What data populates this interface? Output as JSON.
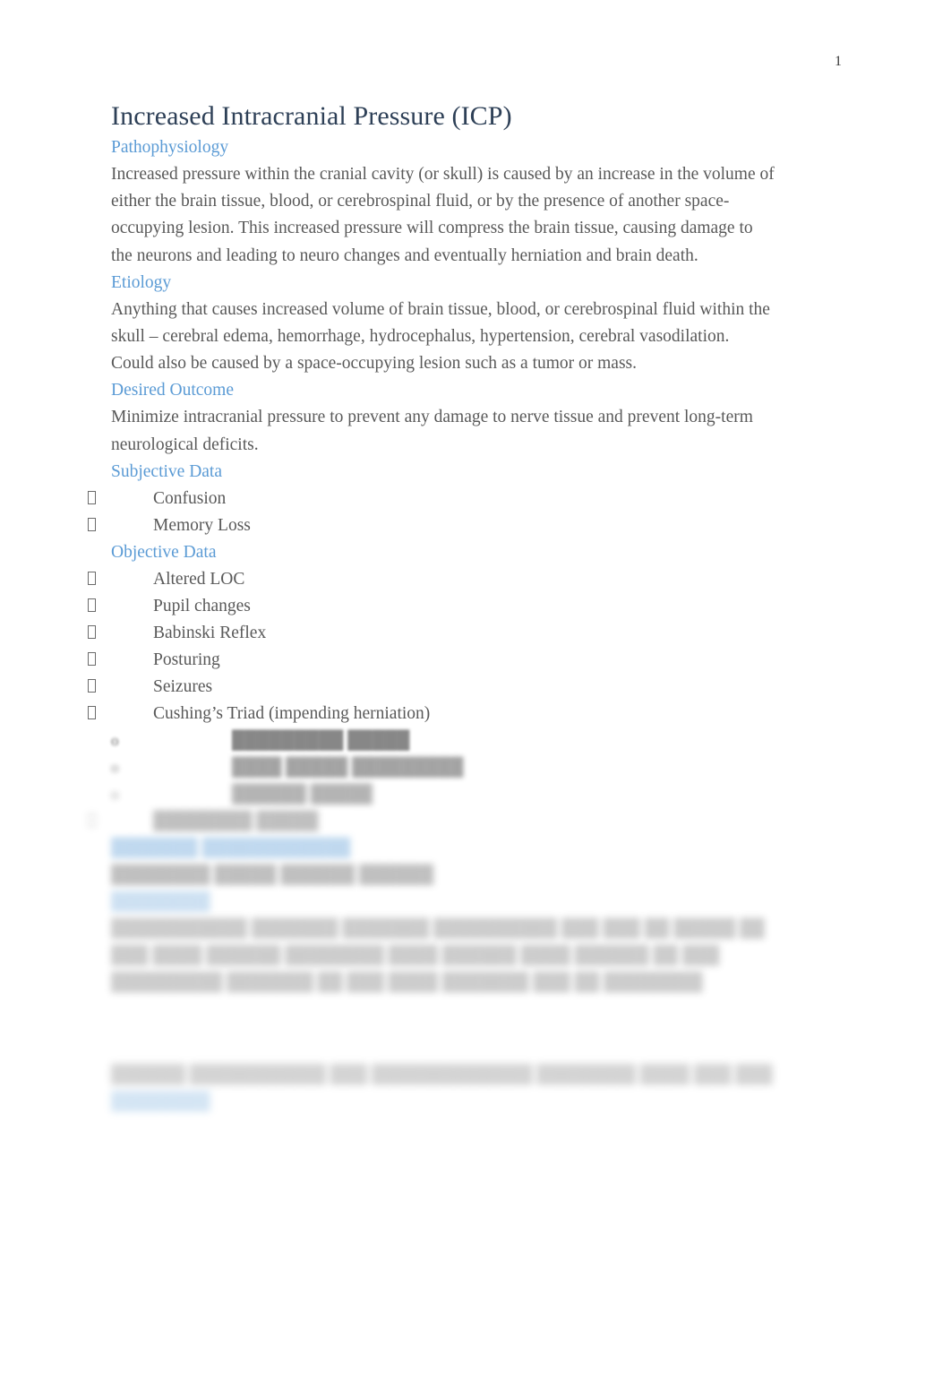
{
  "document": {
    "page_number": "1",
    "title": "Increased Intracranial Pressure (ICP)",
    "colors": {
      "title": "#2E4057",
      "heading": "#5B9BD5",
      "body": "#595959",
      "page_background": "#FFFFFF"
    }
  },
  "sections": {
    "pathophysiology": {
      "heading": "Pathophysiology",
      "body": "Increased pressure within the cranial cavity (or skull) is caused by an increase in the volume of either the brain tissue, blood, or cerebrospinal fluid, or by the presence of another space-occupying lesion. This increased pressure will compress the brain tissue, causing damage to the neurons and leading to neuro changes and eventually herniation and brain death."
    },
    "etiology": {
      "heading": "Etiology",
      "body": "Anything that causes increased volume of brain tissue, blood, or cerebrospinal fluid within the skull – cerebral edema, hemorrhage, hydrocephalus, hypertension, cerebral vasodilation. Could also be caused by a space-occupying lesion such as a tumor or mass."
    },
    "desired_outcome": {
      "heading": "Desired Outcome",
      "body": "Minimize intracranial pressure to prevent any damage to nerve tissue and prevent long-term neurological deficits."
    },
    "subjective_data": {
      "heading": "Subjective Data",
      "items": [
        "Confusion",
        "Memory Loss"
      ]
    },
    "objective_data": {
      "heading": "Objective Data",
      "items": [
        "Altered LOC",
        "Pupil changes",
        "Babinski Reflex",
        "Posturing",
        "Seizures",
        "Cushing’s Triad (impending herniation)"
      ],
      "sub_items": [
        "█████████ █████",
        "████ █████ █████████",
        "██████ █████"
      ],
      "trailing_item": "████████ █████"
    },
    "obscured_block_one": {
      "heading": "███████ ████████████",
      "body": "████████ █████ ██████ ██████"
    },
    "obscured_block_two": {
      "heading": "████████",
      "body": "███████████ ███████ ███████ ██████████ ███ ███ ██ █████ ██ ███ ████ ██████ ████████ ████ ██████ ████ ██████ ██ ███ █████████ ███████ ██ ███ ████ ███████ ███ ██ ████████"
    },
    "obscured_block_three": {
      "body": "██████ ███████████ ███ █████████████ ████████ ████ ███ ███",
      "heading": "████████"
    }
  },
  "icons": {
    "bullet_marker": "missing-glyph-box",
    "sub_bullet_marker": "o"
  }
}
